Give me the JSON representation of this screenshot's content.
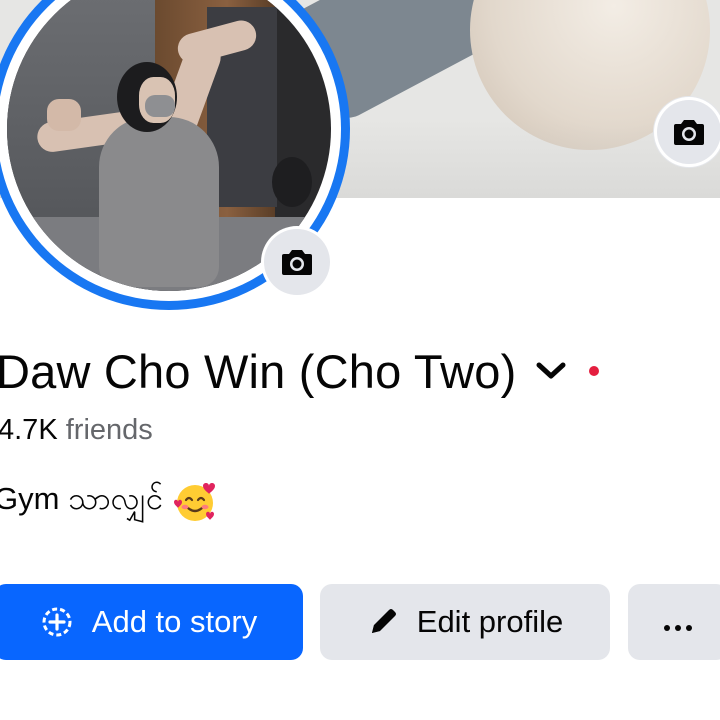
{
  "profile": {
    "name": "Daw Cho Win (Cho Two)",
    "friends_count": "4.7K",
    "friends_label": "friends",
    "bio_text": "Gym သာလျှင်"
  },
  "actions": {
    "add_story_label": "Add to story",
    "edit_profile_label": "Edit profile"
  },
  "icons": {
    "cover_camera": "camera-icon",
    "avatar_camera": "camera-icon",
    "name_menu": "chevron-down-icon",
    "status": "red-dot",
    "bio_emoji": "smiling-face-with-hearts-icon",
    "add_story": "add-story-icon",
    "edit_profile": "pencil-icon",
    "more": "ellipsis-icon"
  },
  "colors": {
    "primary_button": "#0866ff",
    "secondary_button": "#e4e6eb",
    "avatar_ring": "#1877f2",
    "status_dot": "#e41e3f",
    "secondary_text": "#65676b"
  }
}
